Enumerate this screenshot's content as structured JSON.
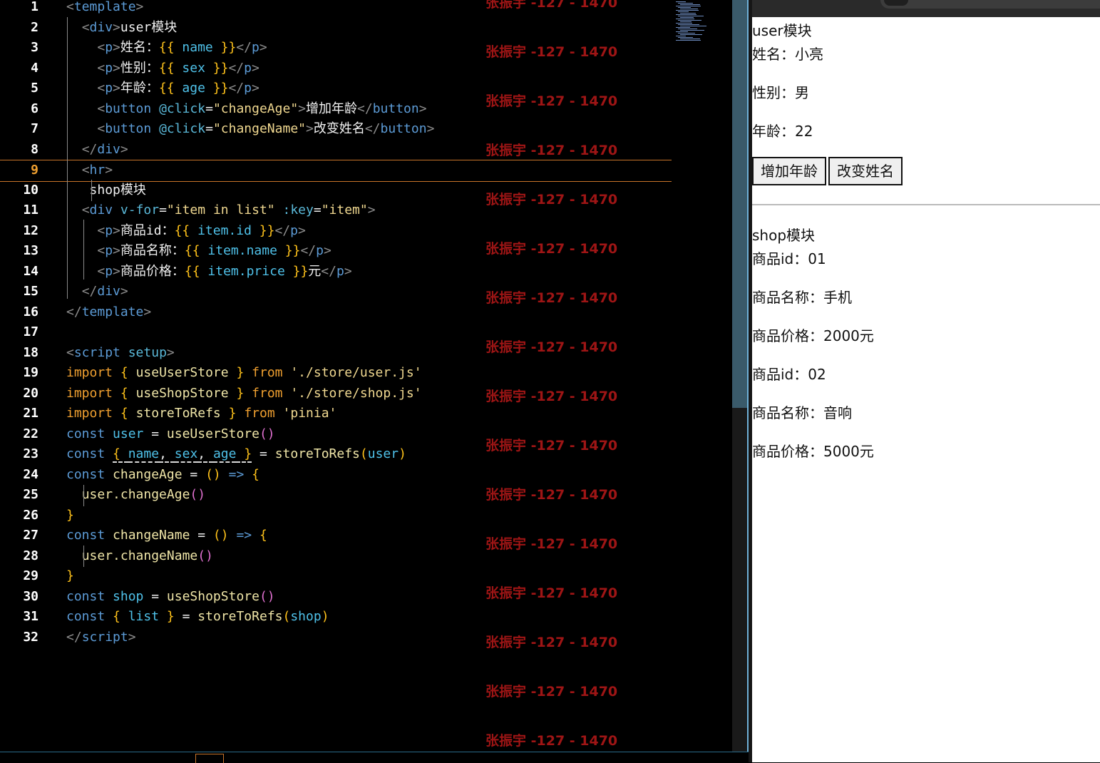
{
  "editor": {
    "line_numbers": [
      "1",
      "2",
      "3",
      "4",
      "5",
      "6",
      "7",
      "8",
      "9",
      "10",
      "11",
      "12",
      "13",
      "14",
      "15",
      "16",
      "17",
      "18",
      "19",
      "20",
      "21",
      "22",
      "23",
      "24",
      "25",
      "26",
      "27",
      "28",
      "29",
      "30",
      "31",
      "32"
    ],
    "active_line": "9",
    "watermark": "张振宇 -127 - 1470",
    "code": {
      "template_tag": "template",
      "div_tag": "div",
      "p_tag": "p",
      "button_tag": "button",
      "hr_tag": "hr",
      "script_tag": "script",
      "user_module_text": "user模块",
      "shop_module_text": "shop模块",
      "label_name": "姓名：",
      "label_sex": "性别：",
      "label_age": "年龄：",
      "var_name": "name",
      "var_sex": "sex",
      "var_age": "age",
      "attr_click": "@click",
      "attr_vfor": "v-for",
      "attr_key": ":key",
      "str_change_age": "\"changeAge\"",
      "str_change_name": "\"changeName\"",
      "str_vfor": "\"item in list\"",
      "str_key": "\"item\"",
      "btn_add_age_text": "增加年龄",
      "btn_change_name_text": "改变姓名",
      "label_goods_id": "商品id",
      "colon": "：",
      "label_goods_name": "商品名称：",
      "label_goods_price": "商品价格：",
      "expr_item_id": "item.id",
      "expr_item_name": "item.name",
      "expr_item_price": "item.price",
      "yuan": "元",
      "kw_setup": "setup",
      "kw_import": "import",
      "kw_from": "from",
      "kw_const": "const",
      "id_use_user_store": "useUserStore",
      "id_use_shop_store": "useShopStore",
      "id_store_to_refs": "storeToRefs",
      "str_user_path": "'./store/user.js'",
      "str_shop_path": "'./store/shop.js'",
      "str_pinia": "'pinia'",
      "id_user": "user",
      "id_shop": "shop",
      "id_list": "list",
      "id_change_age": "changeAge",
      "id_change_name": "changeName",
      "call_user_change_age": "user.changeAge",
      "call_user_change_name": "user.changeName"
    }
  },
  "preview": {
    "user_title": "user模块",
    "user_name": "姓名：小亮",
    "user_sex": "性别：男",
    "user_age": "年龄：22",
    "btn_add_age": "增加年龄",
    "btn_change_name": "改变姓名",
    "shop_title": "shop模块",
    "items": [
      {
        "id": "商品id：01",
        "name": "商品名称：手机",
        "price": "商品价格：2000元"
      },
      {
        "id": "商品id：02",
        "name": "商品名称：音响",
        "price": "商品价格：5000元"
      }
    ]
  }
}
